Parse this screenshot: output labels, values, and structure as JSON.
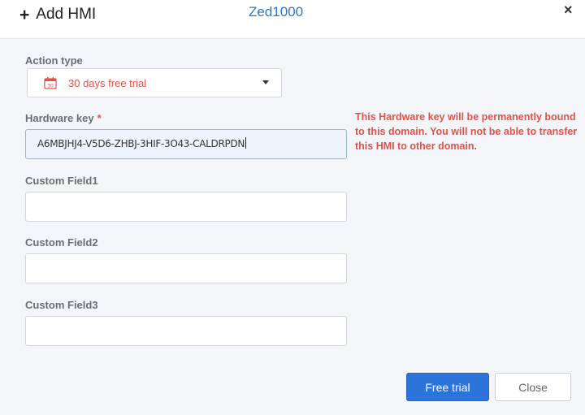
{
  "header": {
    "title": "Add HMI",
    "domain": "Zed1000",
    "close_symbol": "×"
  },
  "action_type": {
    "label": "Action type",
    "value": "30 days free trial",
    "icon": "calendar-icon"
  },
  "hardware_key": {
    "label": "Hardware key",
    "required_mark": "*",
    "value": "A6MBJHJ4-V5D6-ZHBJ-3HIF-3O43-CALDRPDN",
    "warning_lines": [
      "This Hardware key will be permanently bound",
      "to this domain. You will not be able to transfer",
      "this HMI to other domain."
    ]
  },
  "custom_fields": [
    {
      "label": "Custom Field1",
      "value": ""
    },
    {
      "label": "Custom Field2",
      "value": ""
    },
    {
      "label": "Custom Field3",
      "value": ""
    }
  ],
  "buttons": {
    "primary": "Free trial",
    "secondary": "Close"
  },
  "colors": {
    "accent": "#2d74da",
    "error": "#e0534a",
    "domain_link": "#2d74c4"
  }
}
